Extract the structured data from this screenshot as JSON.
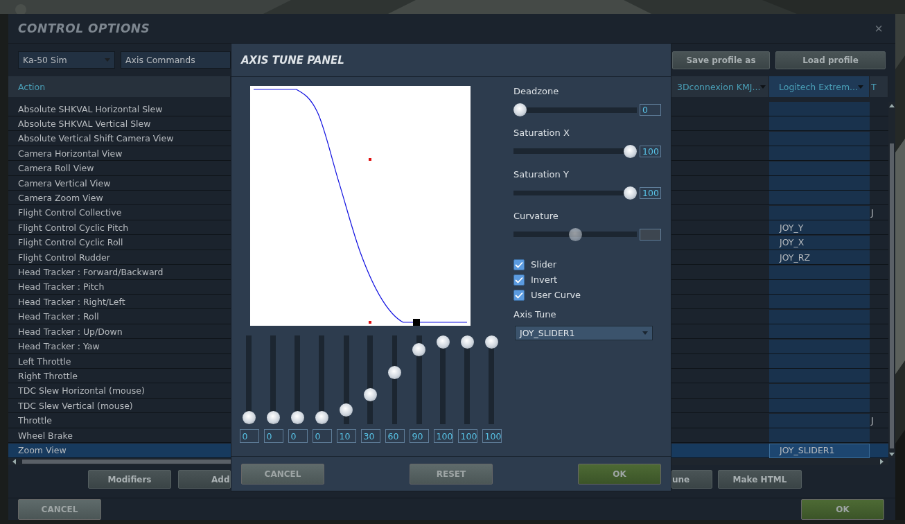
{
  "window": {
    "title": "CONTROL OPTIONS",
    "close": "×"
  },
  "toolbar": {
    "dropdowns": [
      {
        "value": "Ka-50 Sim"
      },
      {
        "value": "Axis Commands"
      }
    ],
    "buttons": [
      "Save profile as",
      "Load profile"
    ]
  },
  "table": {
    "columns": [
      {
        "label": "Action",
        "dropdown": false,
        "selected": false
      },
      {
        "label": "3Dconnexion KMJ...",
        "dropdown": true,
        "selected": false
      },
      {
        "label": "Logitech Extrem...",
        "dropdown": true,
        "selected": true
      },
      {
        "label": "T",
        "dropdown": false,
        "selected": false
      }
    ],
    "rows": [
      {
        "action": "Absolute SHKVAL Horizontal Slew",
        "selected": false
      },
      {
        "action": "Absolute SHKVAL Vertical Slew",
        "selected": false
      },
      {
        "action": "Absolute Vertical Shift Camera View",
        "selected": false
      },
      {
        "action": "Camera Horizontal View",
        "selected": false
      },
      {
        "action": "Camera Roll View",
        "selected": false
      },
      {
        "action": "Camera Vertical View",
        "selected": false
      },
      {
        "action": "Camera Zoom View",
        "selected": false
      },
      {
        "action": "Flight Control Collective",
        "selected": false,
        "column_4": "J"
      },
      {
        "action": "Flight Control Cyclic Pitch",
        "selected": false,
        "logitech": "JOY_Y"
      },
      {
        "action": "Flight Control Cyclic Roll",
        "selected": false,
        "logitech": "JOY_X"
      },
      {
        "action": "Flight Control Rudder",
        "selected": false,
        "logitech": "JOY_RZ"
      },
      {
        "action": "Head Tracker : Forward/Backward",
        "selected": false
      },
      {
        "action": "Head Tracker : Pitch",
        "selected": false
      },
      {
        "action": "Head Tracker : Right/Left",
        "selected": false
      },
      {
        "action": "Head Tracker : Roll",
        "selected": false
      },
      {
        "action": "Head Tracker : Up/Down",
        "selected": false
      },
      {
        "action": "Head Tracker : Yaw",
        "selected": false
      },
      {
        "action": "Left Throttle",
        "selected": false
      },
      {
        "action": "Right Throttle",
        "selected": false
      },
      {
        "action": "TDC Slew Horizontal (mouse)",
        "selected": false
      },
      {
        "action": "TDC Slew Vertical (mouse)",
        "selected": false
      },
      {
        "action": "Throttle",
        "selected": false,
        "column_4": "J"
      },
      {
        "action": "Wheel Brake",
        "selected": false
      },
      {
        "action": "Zoom View",
        "selected": true,
        "logitech": "JOY_SLIDER1"
      }
    ]
  },
  "bottom_buttons": [
    "Modifiers",
    "Add",
    "une",
    "Make HTML"
  ],
  "footer_buttons": [
    {
      "label": "CANCEL",
      "kind": "neutral"
    },
    {
      "label": "OK",
      "kind": "confirm"
    }
  ],
  "axis_tune_panel": {
    "title": "AXIS TUNE PANEL",
    "curve_sliders": [
      {
        "level": 0,
        "value": "0"
      },
      {
        "level": 0,
        "value": "0"
      },
      {
        "level": 0,
        "value": "0"
      },
      {
        "level": 0,
        "value": "0"
      },
      {
        "level": 0.1,
        "value": "10"
      },
      {
        "level": 0.3,
        "value": "30"
      },
      {
        "level": 0.6,
        "value": "60"
      },
      {
        "level": 0.9,
        "value": "90"
      },
      {
        "level": 1,
        "value": "100"
      },
      {
        "level": 1,
        "value": "100"
      },
      {
        "level": 1,
        "value": "100"
      }
    ],
    "settings": [
      {
        "label": "Deadzone",
        "level": 0,
        "value": "0",
        "disabled": false
      },
      {
        "label": "Saturation X",
        "level": 1,
        "value": "100",
        "disabled": false
      },
      {
        "label": "Saturation Y",
        "level": 1,
        "value": "100",
        "disabled": false
      },
      {
        "label": "Curvature",
        "level": 0.5,
        "disabled": true
      }
    ],
    "checkboxes": [
      {
        "label": "Slider",
        "checked": true
      },
      {
        "label": "Invert",
        "checked": true
      },
      {
        "label": "User Curve",
        "checked": true
      }
    ],
    "axis_tune": {
      "label": "Axis Tune",
      "value": "JOY_SLIDER1"
    },
    "buttons": [
      {
        "label": "CANCEL",
        "kind": "neutral"
      },
      {
        "label": "RESET",
        "kind": "neutral"
      },
      {
        "label": "OK",
        "kind": "confirm"
      }
    ]
  }
}
